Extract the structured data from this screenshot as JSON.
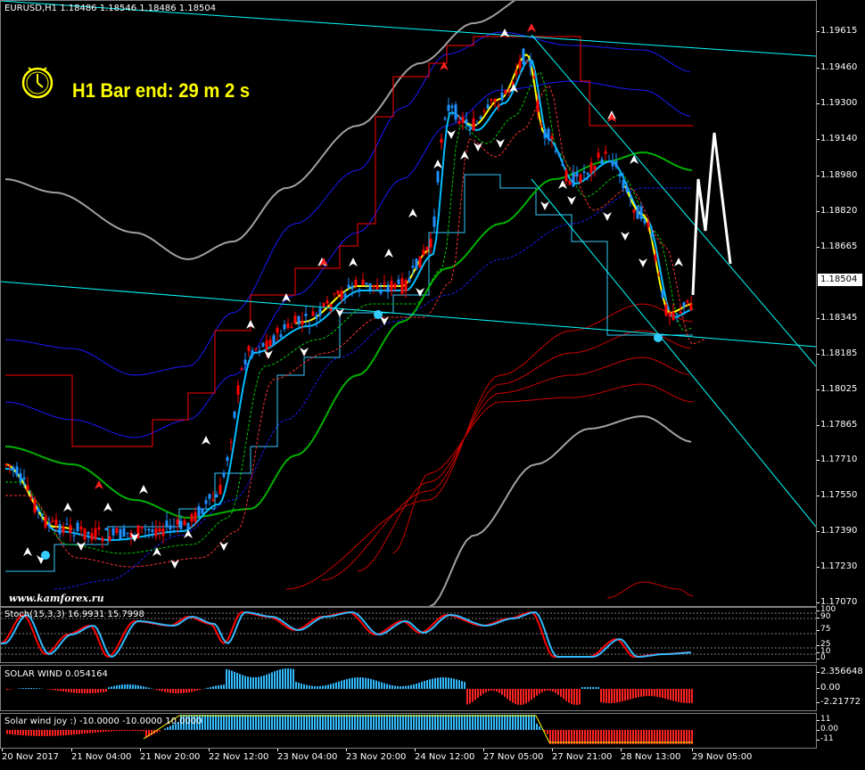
{
  "chart": {
    "symbol_header": "EURUSD,H1  1.18486 1.18546 1.18486 1.18504",
    "timer_text": "H1 Bar end: 29 m 2 s",
    "watermark": "www.kamforex.ru",
    "current_price": "1.18504",
    "price_axis": [
      "1.19615",
      "1.19460",
      "1.19300",
      "1.19140",
      "1.18980",
      "1.18820",
      "1.18665",
      "1.18345",
      "1.18185",
      "1.18025",
      "1.17865",
      "1.17710",
      "1.17550",
      "1.17390",
      "1.17230",
      "1.17070"
    ],
    "time_axis": [
      "20 Nov 2017",
      "21 Nov 04:00",
      "21 Nov 20:00",
      "22 Nov 12:00",
      "23 Nov 04:00",
      "23 Nov 20:00",
      "24 Nov 12:00",
      "27 Nov 05:00",
      "27 Nov 21:00",
      "28 Nov 13:00",
      "29 Nov 05:00"
    ],
    "colors": {
      "background": "#000000",
      "up_candle": "#1e90ff",
      "down_candle": "#ff0000",
      "accent": "#ffff00",
      "channel": "#00ffff"
    }
  },
  "stoch": {
    "label": "Stoch(15,3,3) 16.9931 15.7998",
    "axis": [
      "100",
      "90",
      "75",
      "25",
      "10",
      "0"
    ]
  },
  "solar_wind": {
    "label": "SOLAR WIND 0.054164",
    "axis": [
      "2.356648",
      "0.00",
      "-2.21772"
    ]
  },
  "solar_wind_joy": {
    "label": "Solar wind joy :) -10.0000 -10.0000 10.0000",
    "axis": [
      "11",
      "0.00",
      "-11"
    ]
  }
}
